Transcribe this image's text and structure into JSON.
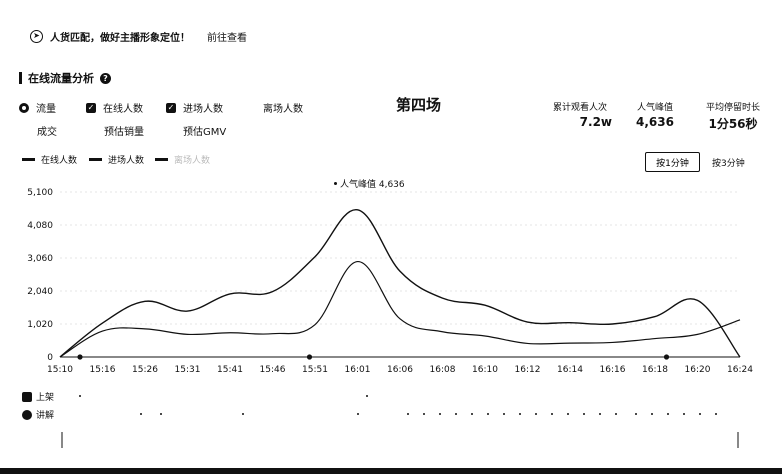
{
  "tip": {
    "text": "人货匹配，做好主播形象定位！",
    "link": "前往查看",
    "icon": "compass-icon"
  },
  "section": {
    "title": "在线流量分析",
    "help_icon": "?"
  },
  "metrics": {
    "row1": [
      {
        "label": "流量",
        "control": "radio"
      },
      {
        "label": "在线人数",
        "control": "checkbox"
      },
      {
        "label": "进场人数",
        "control": "checkbox"
      },
      {
        "label": "离场人数",
        "control": "none"
      }
    ],
    "row2": [
      {
        "label": "成交"
      },
      {
        "label": "预估销量"
      },
      {
        "label": "预估GMV"
      }
    ]
  },
  "session": {
    "title": "第四场"
  },
  "stats": [
    {
      "label": "累计观看人次",
      "value": "7.2w"
    },
    {
      "label": "人气峰值",
      "value": "4,636"
    },
    {
      "label": "平均停留时长",
      "value": "1分56秒"
    }
  ],
  "legend": [
    {
      "label": "在线人数",
      "active": true
    },
    {
      "label": "进场人数",
      "active": true
    },
    {
      "label": "离场人数",
      "active": false
    }
  ],
  "granularity": {
    "minute": "按1分钟",
    "three_minutes": "按3分钟"
  },
  "peak_annotation": "人气峰值 4,636",
  "rows": {
    "shelf": "上架",
    "explain": "讲解"
  },
  "colors": {
    "line": "#111111",
    "grid": "#e6e6e6"
  },
  "chart_data": {
    "type": "line",
    "x": [
      "15:10",
      "15:16",
      "15:26",
      "15:31",
      "15:41",
      "15:46",
      "15:51",
      "16:01",
      "16:06",
      "16:08",
      "16:10",
      "16:12",
      "16:14",
      "16:16",
      "16:18",
      "16:20",
      "16:24"
    ],
    "ylim": [
      0,
      5100
    ],
    "yticks": [
      "0",
      "1,020",
      "2,040",
      "3,060",
      "4,080",
      "5,100"
    ],
    "series": [
      {
        "name": "在线人数",
        "values": [
          0,
          1050,
          1720,
          1420,
          1950,
          2020,
          3100,
          4550,
          2650,
          1820,
          1600,
          1080,
          1060,
          1020,
          1250,
          1750,
          0
        ]
      },
      {
        "name": "进场人数",
        "values": [
          0,
          800,
          870,
          700,
          750,
          720,
          1000,
          2950,
          1180,
          780,
          650,
          420,
          430,
          450,
          570,
          700,
          1150
        ]
      }
    ],
    "peak": {
      "label": "人气峰值",
      "value": 4636
    }
  }
}
